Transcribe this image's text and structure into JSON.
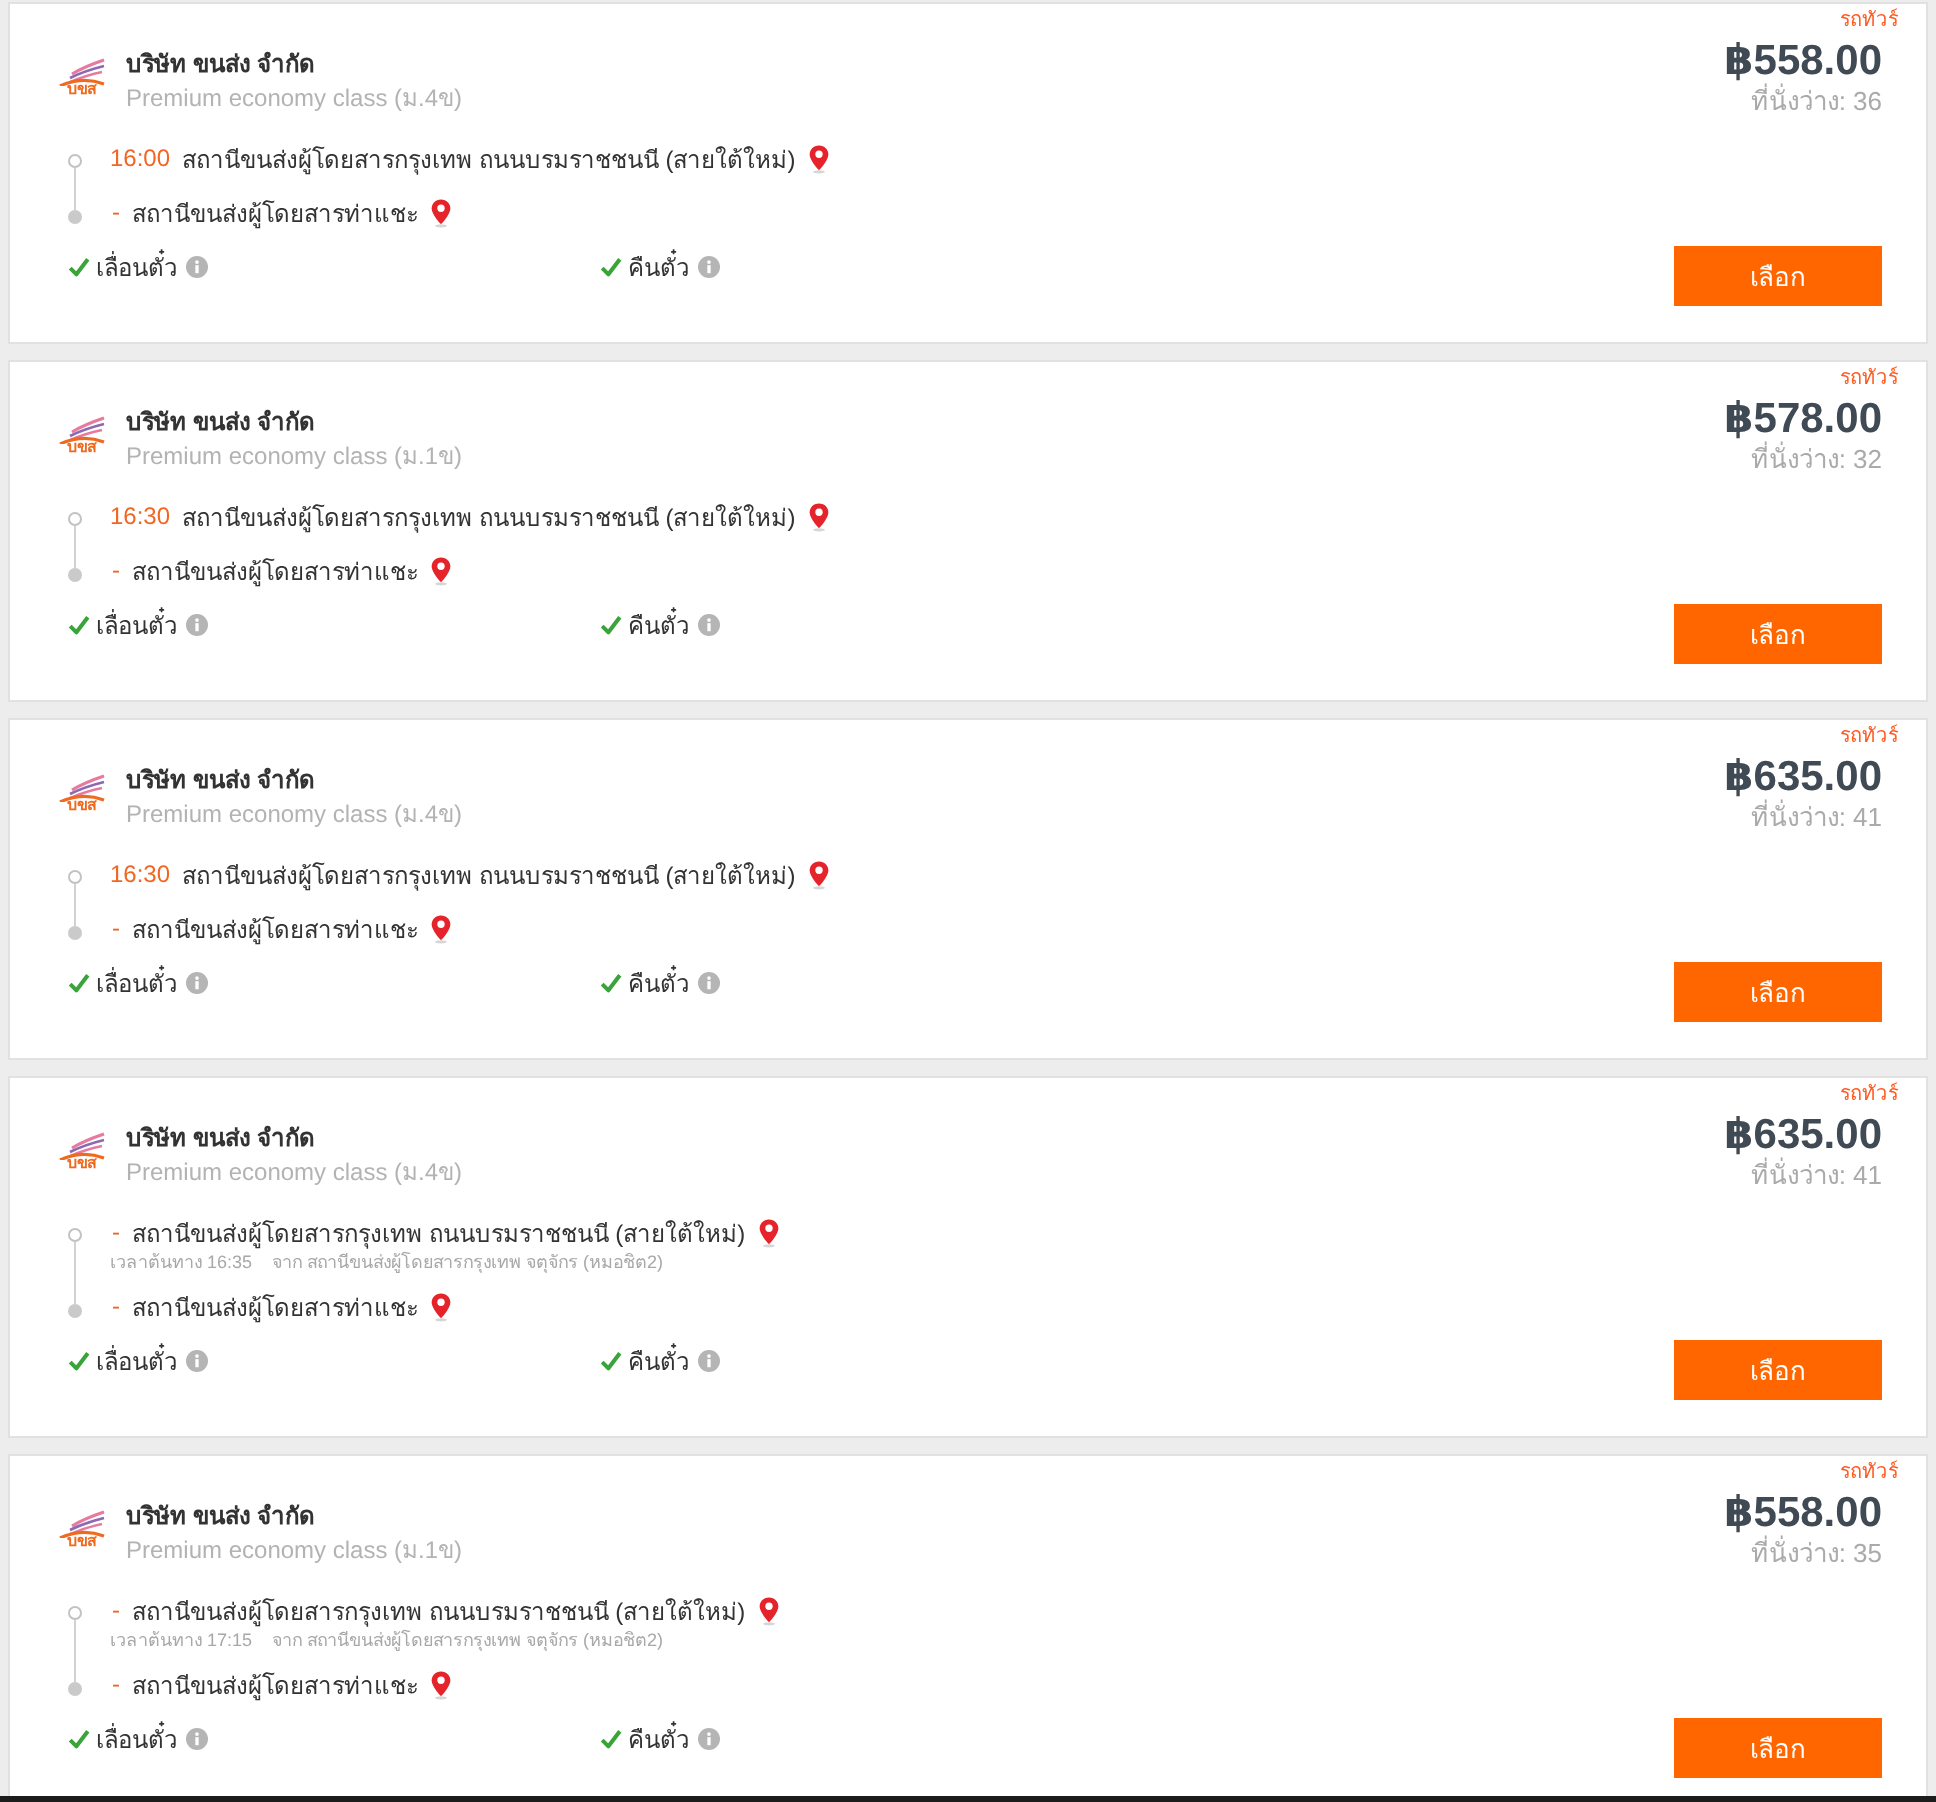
{
  "trips": [
    {
      "operator": "บริษัท ขนส่ง จำกัด",
      "logo_text": "บขส",
      "service_class": "Premium economy class (ม.4ข)",
      "vehicle_type": "รถทัวร์",
      "price": "฿558.00",
      "seats": "ที่นั่งว่าง: 36",
      "stops": [
        {
          "kind": "time",
          "lead": "16:00",
          "station": "สถานีขนส่งผู้โดยสารกรุงเทพ ถนนบรมราชชนนี (สายใต้ใหม่)"
        },
        {
          "kind": "dash",
          "lead": "-",
          "station": "สถานีขนส่งผู้โดยสารท่าแชะ"
        }
      ],
      "features": [
        {
          "label": "เลื่อนตั๋ว",
          "available": true
        },
        {
          "label": "คืนตั๋ว",
          "available": true
        }
      ],
      "button": "เลือก"
    },
    {
      "operator": "บริษัท ขนส่ง จำกัด",
      "logo_text": "บขส",
      "service_class": "Premium economy class (ม.1ข)",
      "vehicle_type": "รถทัวร์",
      "price": "฿578.00",
      "seats": "ที่นั่งว่าง: 32",
      "stops": [
        {
          "kind": "time",
          "lead": "16:30",
          "station": "สถานีขนส่งผู้โดยสารกรุงเทพ ถนนบรมราชชนนี (สายใต้ใหม่)"
        },
        {
          "kind": "dash",
          "lead": "-",
          "station": "สถานีขนส่งผู้โดยสารท่าแชะ"
        }
      ],
      "features": [
        {
          "label": "เลื่อนตั๋ว",
          "available": true
        },
        {
          "label": "คืนตั๋ว",
          "available": true
        }
      ],
      "button": "เลือก"
    },
    {
      "operator": "บริษัท ขนส่ง จำกัด",
      "logo_text": "บขส",
      "service_class": "Premium economy class (ม.4ข)",
      "vehicle_type": "รถทัวร์",
      "price": "฿635.00",
      "seats": "ที่นั่งว่าง: 41",
      "stops": [
        {
          "kind": "time",
          "lead": "16:30",
          "station": "สถานีขนส่งผู้โดยสารกรุงเทพ ถนนบรมราชชนนี (สายใต้ใหม่)"
        },
        {
          "kind": "dash",
          "lead": "-",
          "station": "สถานีขนส่งผู้โดยสารท่าแชะ"
        }
      ],
      "features": [
        {
          "label": "เลื่อนตั๋ว",
          "available": true
        },
        {
          "label": "คืนตั๋ว",
          "available": true
        }
      ],
      "button": "เลือก"
    },
    {
      "operator": "บริษัท ขนส่ง จำกัด",
      "logo_text": "บขส",
      "service_class": "Premium economy class (ม.4ข)",
      "vehicle_type": "รถทัวร์",
      "price": "฿635.00",
      "seats": "ที่นั่งว่าง: 41",
      "stops": [
        {
          "kind": "dash",
          "lead": "-",
          "station": "สถานีขนส่งผู้โดยสารกรุงเทพ ถนนบรมราชชนนี (สายใต้ใหม่)",
          "departure_note": "เวลาต้นทาง 16:35",
          "origin_note": "จาก สถานีขนส่งผู้โดยสารกรุงเทพ จตุจักร (หมอชิต2)"
        },
        {
          "kind": "dash",
          "lead": "-",
          "station": "สถานีขนส่งผู้โดยสารท่าแชะ"
        }
      ],
      "features": [
        {
          "label": "เลื่อนตั๋ว",
          "available": true
        },
        {
          "label": "คืนตั๋ว",
          "available": true
        }
      ],
      "button": "เลือก"
    },
    {
      "operator": "บริษัท ขนส่ง จำกัด",
      "logo_text": "บขส",
      "service_class": "Premium economy class (ม.1ข)",
      "vehicle_type": "รถทัวร์",
      "price": "฿558.00",
      "seats": "ที่นั่งว่าง: 35",
      "stops": [
        {
          "kind": "dash",
          "lead": "-",
          "station": "สถานีขนส่งผู้โดยสารกรุงเทพ ถนนบรมราชชนนี (สายใต้ใหม่)",
          "departure_note": "เวลาต้นทาง 17:15",
          "origin_note": "จาก สถานีขนส่งผู้โดยสารกรุงเทพ จตุจักร (หมอชิต2)"
        },
        {
          "kind": "dash",
          "lead": "-",
          "station": "สถานีขนส่งผู้โดยสารท่าแชะ"
        }
      ],
      "features": [
        {
          "label": "เลื่อนตั๋ว",
          "available": true
        },
        {
          "label": "คืนตั๋ว",
          "available": true
        }
      ],
      "button": "เลือก"
    }
  ]
}
